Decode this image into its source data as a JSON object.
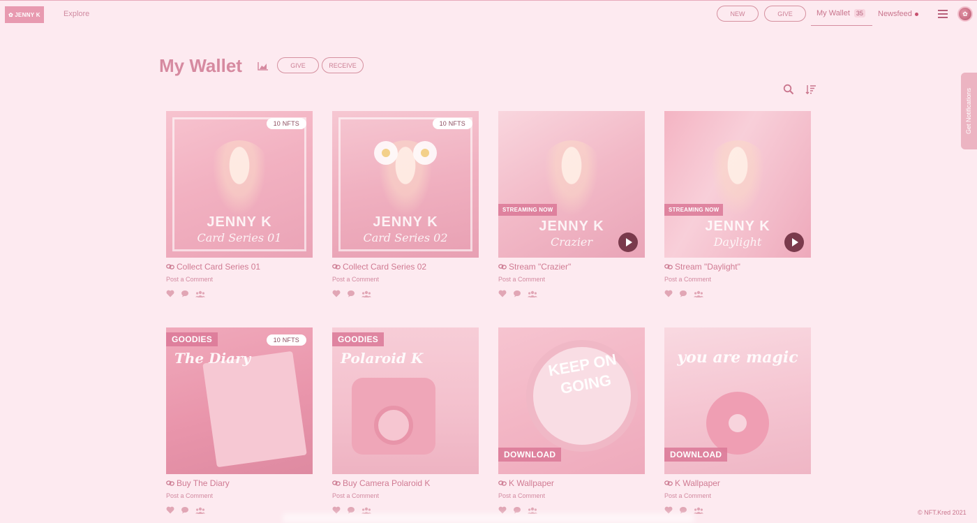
{
  "nav": {
    "logo": "JENNY K",
    "explore": "Explore",
    "new_label": "NEW",
    "give_label": "GIVE",
    "wallet_label": "My Wallet",
    "wallet_count": "35",
    "newsfeed_label": "Newsfeed"
  },
  "notifications_tab": "Get Notifications",
  "header": {
    "title": "My Wallet",
    "give_label": "GIVE",
    "receive_label": "RECEIVE"
  },
  "cards": [
    {
      "title": "Collect Card Series 01",
      "comment": "Post a Comment",
      "badge": "10 NFTS",
      "brand": "JENNY K",
      "script": "Card Series 01"
    },
    {
      "title": "Collect Card Series 02",
      "comment": "Post a Comment",
      "badge": "10 NFTS",
      "brand": "JENNY K",
      "script": "Card Series 02"
    },
    {
      "title": "Stream \"Crazier\"",
      "comment": "Post a Comment",
      "tag": "STREAMING NOW",
      "brand": "JENNY K",
      "script": "Crazier"
    },
    {
      "title": "Stream \"Daylight\"",
      "comment": "Post a Comment",
      "tag": "STREAMING NOW",
      "brand": "JENNY K",
      "script": "Daylight"
    },
    {
      "title": "Buy The Diary",
      "comment": "Post a Comment",
      "badge": "10 NFTS",
      "tag": "GOODIES",
      "script": "The Diary"
    },
    {
      "title": "Buy Camera Polaroid K",
      "comment": "Post a Comment",
      "tag": "GOODIES",
      "script": "Polaroid K"
    },
    {
      "title": "K Wallpaper",
      "comment": "Post a Comment",
      "tag": "DOWNLOAD",
      "script": "KEEP ON GOING"
    },
    {
      "title": "K Wallpaper",
      "comment": "Post a Comment",
      "tag": "DOWNLOAD",
      "script": "you are magic"
    }
  ],
  "footer": {
    "copyright": "© NFT.Kred 2021"
  },
  "colors": {
    "background": "#fdeaf0",
    "accent": "#d68aa0",
    "play_button": "#7a3a4c"
  }
}
